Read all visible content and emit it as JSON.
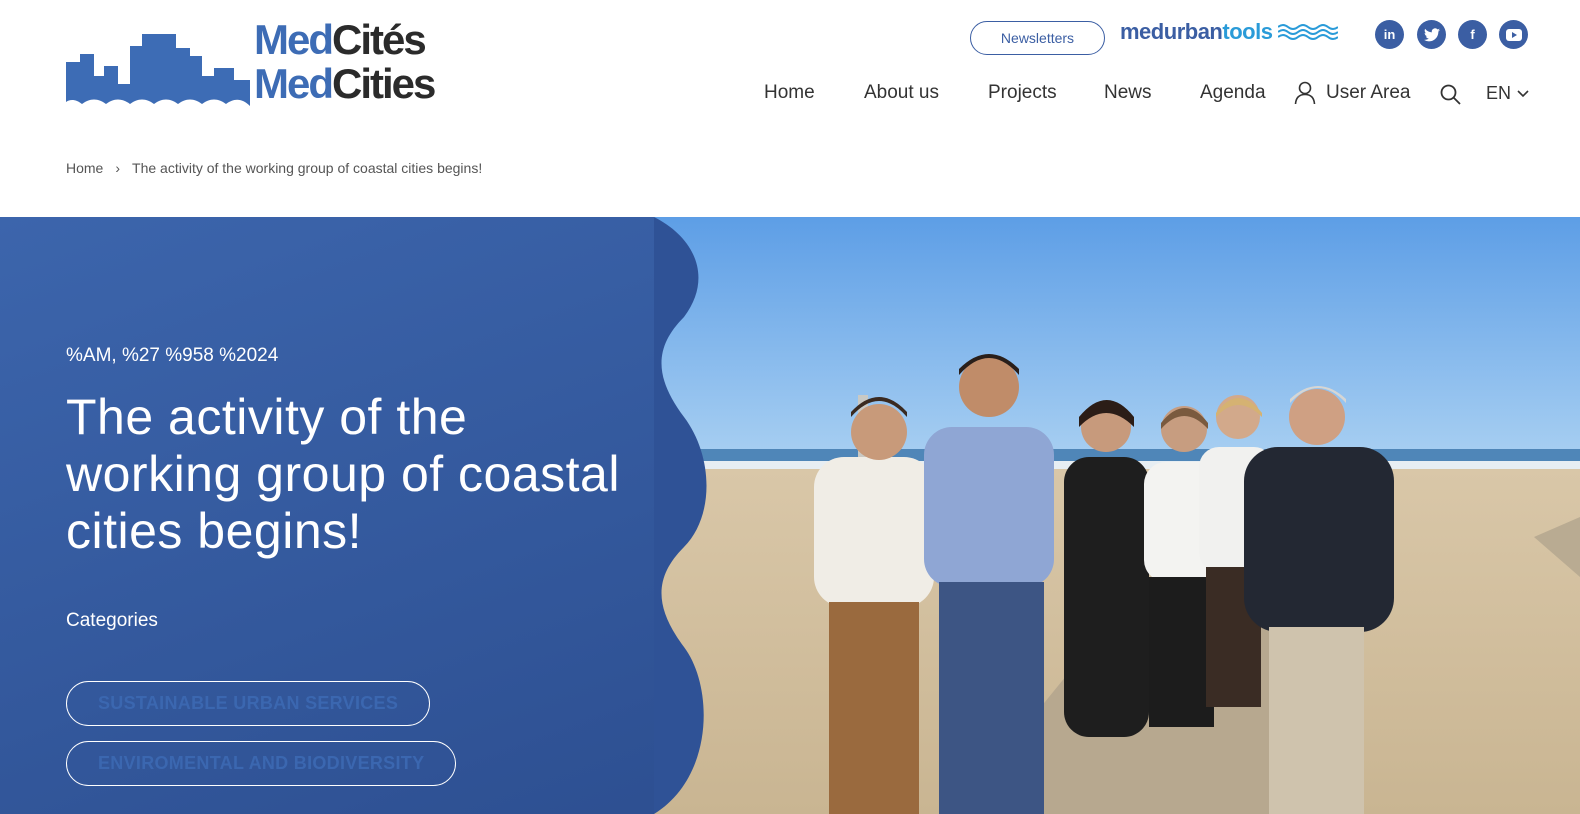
{
  "brand": {
    "logo_line1_a": "Med",
    "logo_line1_b": "Cités",
    "logo_line2_a": "Med",
    "logo_line2_b": "Cities",
    "brand_color": "#3d6cb5"
  },
  "topbar": {
    "newsletter_label": "Newsletters",
    "partner_logo_a": "med",
    "partner_logo_b": "urban",
    "partner_logo_c": "tools",
    "social": [
      {
        "icon": "linkedin-icon",
        "glyph": "in"
      },
      {
        "icon": "twitter-icon",
        "glyph": "t"
      },
      {
        "icon": "facebook-icon",
        "glyph": "f"
      },
      {
        "icon": "youtube-icon",
        "glyph": "▶"
      }
    ]
  },
  "nav": {
    "items": [
      "Home",
      "About us",
      "Projects",
      "News",
      "Agenda"
    ],
    "user_area": "User Area",
    "language": "EN"
  },
  "breadcrumb": {
    "home": "Home",
    "separator": "›",
    "current": "The activity of the working group of coastal cities begins!"
  },
  "hero": {
    "date": "%AM, %27 %958 %2024",
    "title": "The activity of the working group of coastal cities begins!",
    "categories_label": "Categories",
    "categories": [
      "SUSTAINABLE URBAN SERVICES",
      "ENVIROMENTAL AND BIODIVERSITY"
    ],
    "bg_color": "#3c65ac"
  }
}
